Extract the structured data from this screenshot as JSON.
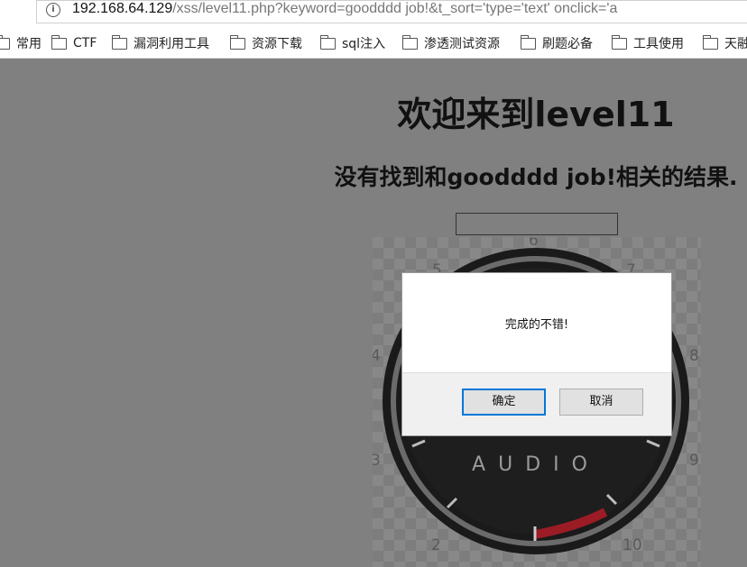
{
  "browser": {
    "url_host": "192.168.64.129",
    "url_rest": "/xss/level11.php?keyword=goodddd job!&t_sort='type='text' onclick='a"
  },
  "bookmarks": {
    "items": [
      {
        "label": "常用"
      },
      {
        "label": "CTF"
      },
      {
        "label": "漏洞利用工具"
      },
      {
        "label": "资源下载"
      },
      {
        "label": "sql注入"
      },
      {
        "label": "渗透测试资源"
      },
      {
        "label": "刷题必备"
      },
      {
        "label": "工具使用"
      },
      {
        "label": "天融"
      }
    ]
  },
  "page": {
    "title": "欢迎来到level11",
    "subtitle": "没有找到和goodddd job!相关的结果.",
    "search_value": ""
  },
  "gauge_image": {
    "label": "AUDIO",
    "dial_numbers": [
      "2",
      "3",
      "4",
      "5",
      "6",
      "7",
      "8",
      "9",
      "10"
    ]
  },
  "dialog": {
    "message": "完成的不错!",
    "ok_label": "确定",
    "cancel_label": "取消"
  },
  "colors": {
    "overlay_bg": "#808080",
    "dialog_bg": "#f0f0f0",
    "ok_border": "#0078d7"
  }
}
